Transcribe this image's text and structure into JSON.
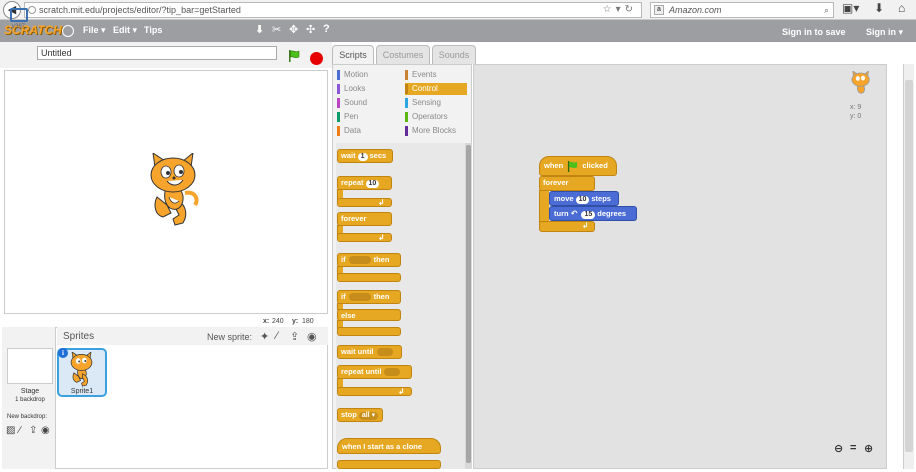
{
  "browser": {
    "url": "scratch.mit.edu/projects/editor/?tip_bar=getStarted",
    "search_engine": "Amazon.com"
  },
  "menubar": {
    "logo": "SCRATCH",
    "file": "File ▾",
    "edit": "Edit ▾",
    "tips": "Tips",
    "sign_in_to_save": "Sign in to save",
    "sign_in": "Sign in ▾"
  },
  "stage": {
    "version": "v367",
    "project_title": "Untitled",
    "mouse_x_label": "x:",
    "mouse_x": "240",
    "mouse_y_label": "y:",
    "mouse_y": "180"
  },
  "sprites": {
    "title": "Sprites",
    "new_sprite_label": "New sprite:",
    "stage_label": "Stage",
    "backdrops": "1 backdrop",
    "new_backdrop": "New backdrop:",
    "sprite1": "Sprite1"
  },
  "tabs": {
    "scripts": "Scripts",
    "costumes": "Costumes",
    "sounds": "Sounds"
  },
  "categories": {
    "motion": "Motion",
    "looks": "Looks",
    "sound": "Sound",
    "pen": "Pen",
    "data": "Data",
    "events": "Events",
    "control": "Control",
    "sensing": "Sensing",
    "operators": "Operators",
    "more": "More Blocks"
  },
  "palette": {
    "wait": "wait",
    "wait_val": "1",
    "secs": "secs",
    "repeat": "repeat",
    "repeat_val": "10",
    "forever": "forever",
    "if": "if",
    "then": "then",
    "if2": "if",
    "then2": "then",
    "else": "else",
    "wait_until": "wait until",
    "repeat_until": "repeat until",
    "stop": "stop",
    "stop_val": "all ▾",
    "clone": "when I start as a clone"
  },
  "script": {
    "when": "when",
    "clicked": "clicked",
    "forever": "forever",
    "move": "move",
    "move_val": "10",
    "steps": "steps",
    "turn": "turn",
    "turn_val": "15",
    "degrees": "degrees"
  },
  "sprite_info": {
    "x_label": "x:",
    "x": "9",
    "y_label": "y:",
    "y": "0"
  },
  "colors": {
    "motion": "#4a6cd4",
    "looks": "#8a55d7",
    "sound": "#bb42c3",
    "pen": "#0e9a6c",
    "data": "#ee7d16",
    "events": "#c88330",
    "control": "#e6a822",
    "sensing": "#2ca5e2",
    "operators": "#5cb712",
    "more": "#632d99"
  }
}
